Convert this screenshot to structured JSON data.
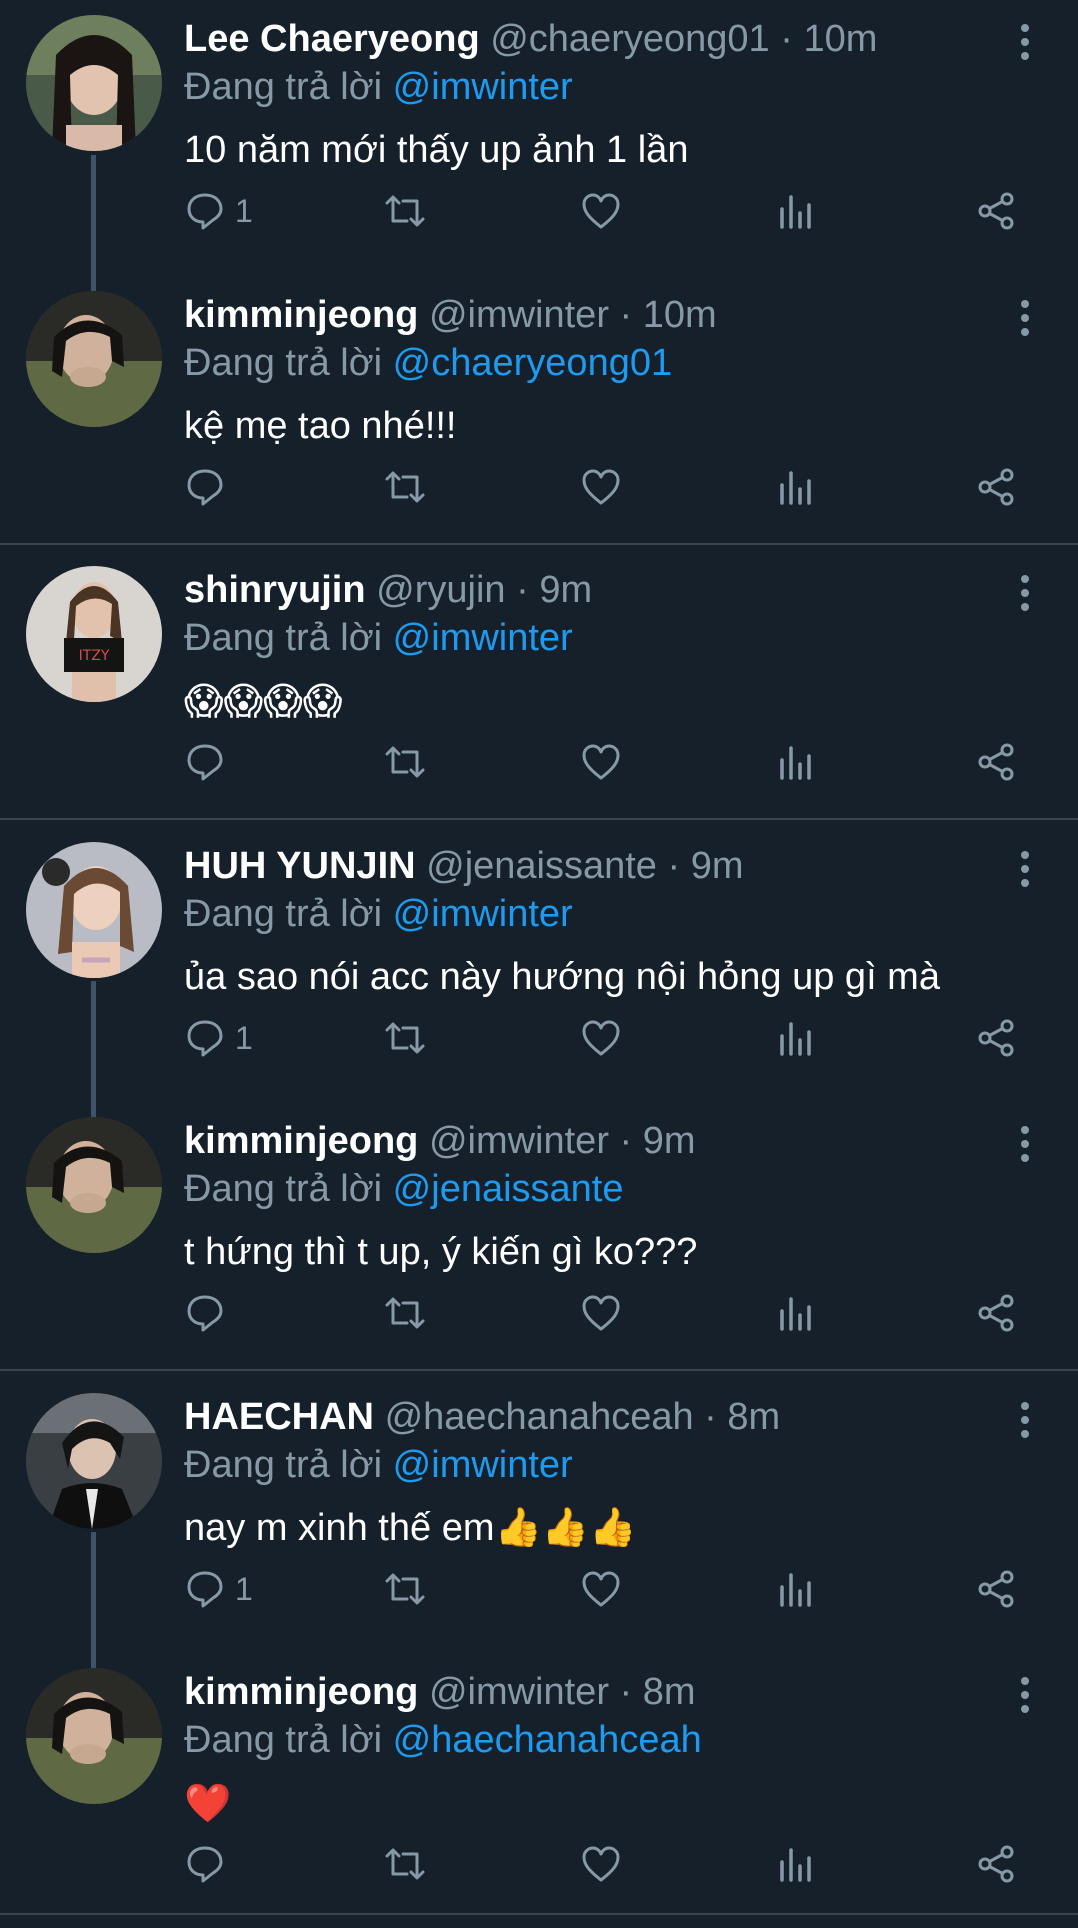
{
  "reply_prefix": "Đang trả lời",
  "separator": "·",
  "colors": {
    "background": "#15202b",
    "text": "#ffffff",
    "muted": "#8899a6",
    "mention": "#1d9bf0",
    "divider": "#38444d",
    "thread_line": "#3d5466"
  },
  "tweets": [
    {
      "name": "Lee Chaeryeong",
      "handle": "@chaeryeong01",
      "time": "10m",
      "reply_to": "@imwinter",
      "text": "10 năm mới thấy up ảnh 1 lần",
      "reply_count": "1",
      "avatar_icon": "avatar-photo"
    },
    {
      "name": "kimminjeong",
      "handle": "@imwinter",
      "time": "10m",
      "reply_to": "@chaeryeong01",
      "text": "kệ mẹ tao nhé!!!",
      "reply_count": "",
      "avatar_icon": "avatar-photo"
    },
    {
      "name": "shinryujin",
      "handle": "@ryujin",
      "time": "9m",
      "reply_to": "@imwinter",
      "text": "😱😱😱😱",
      "reply_count": "",
      "avatar_icon": "avatar-photo"
    },
    {
      "name": "HUH YUNJIN",
      "handle": "@jenaissante",
      "time": "9m",
      "reply_to": "@imwinter",
      "text": "ủa sao nói acc này hướng nội hỏng up gì mà",
      "reply_count": "1",
      "avatar_icon": "avatar-photo"
    },
    {
      "name": "kimminjeong",
      "handle": "@imwinter",
      "time": "9m",
      "reply_to": "@jenaissante",
      "text": "t hứng thì t up, ý kiến gì ko???",
      "reply_count": "",
      "avatar_icon": "avatar-photo"
    },
    {
      "name": "HAECHAN",
      "handle": "@haechanahceah",
      "time": "8m",
      "reply_to": "@imwinter",
      "text": "nay m xinh thế em👍👍👍",
      "reply_count": "1",
      "avatar_icon": "avatar-photo"
    },
    {
      "name": "kimminjeong",
      "handle": "@imwinter",
      "time": "8m",
      "reply_to": "@haechanahceah",
      "text": "❤️",
      "reply_count": "",
      "avatar_icon": "avatar-photo"
    }
  ]
}
